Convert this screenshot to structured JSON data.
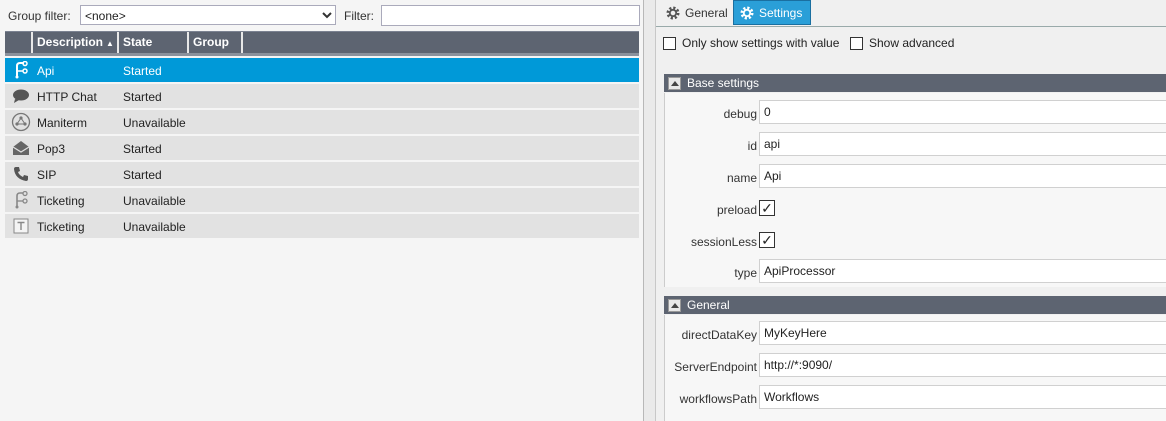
{
  "left": {
    "group_filter_label": "Group filter:",
    "group_filter_value": "<none>",
    "filter_label": "Filter:",
    "filter_value": "",
    "columns": [
      "Description",
      "State",
      "Group"
    ],
    "sort_indicator": "▲",
    "rows": [
      {
        "icon": "api-route-icon",
        "description": "Api",
        "state": "Started",
        "group": "",
        "selected": true
      },
      {
        "icon": "chat-bubble-icon",
        "description": "HTTP Chat",
        "state": "Started",
        "group": ""
      },
      {
        "icon": "maniterm-icon",
        "description": "Maniterm",
        "state": "Unavailable",
        "group": ""
      },
      {
        "icon": "mail-icon",
        "description": "Pop3",
        "state": "Started",
        "group": ""
      },
      {
        "icon": "phone-icon",
        "description": "SIP",
        "state": "Started",
        "group": ""
      },
      {
        "icon": "workflow-route-icon",
        "description": "Ticketing",
        "state": "Unavailable",
        "group": ""
      },
      {
        "icon": "text-box-icon",
        "description": "Ticketing",
        "state": "Unavailable",
        "group": ""
      }
    ]
  },
  "right": {
    "tabs": [
      {
        "label": "General",
        "icon": "gear-icon",
        "active": false
      },
      {
        "label": "Settings",
        "icon": "gear-icon",
        "active": true
      }
    ],
    "only_show_with_value_label": "Only show settings with value",
    "show_advanced_label": "Show advanced",
    "sections": [
      {
        "title": "Base settings",
        "props": [
          {
            "name": "debug",
            "value": "0",
            "kind": "text"
          },
          {
            "name": "id",
            "value": "api",
            "kind": "text"
          },
          {
            "name": "name",
            "value": "Api",
            "kind": "text"
          },
          {
            "name": "preload",
            "value": "✓",
            "kind": "check"
          },
          {
            "name": "sessionLess",
            "value": "✓",
            "kind": "check"
          },
          {
            "name": "type",
            "value": "ApiProcessor",
            "kind": "text"
          }
        ]
      },
      {
        "title": "General",
        "props": [
          {
            "name": "directDataKey",
            "value": "MyKeyHere",
            "kind": "text"
          },
          {
            "name": "ServerEndpoint",
            "value": "http://*:9090/",
            "kind": "text"
          },
          {
            "name": "workflowsPath",
            "value": "Workflows",
            "kind": "text"
          }
        ]
      }
    ]
  },
  "colors": {
    "accent": "#0099d8",
    "header": "#5d6471",
    "row": "#e2e2e2"
  }
}
